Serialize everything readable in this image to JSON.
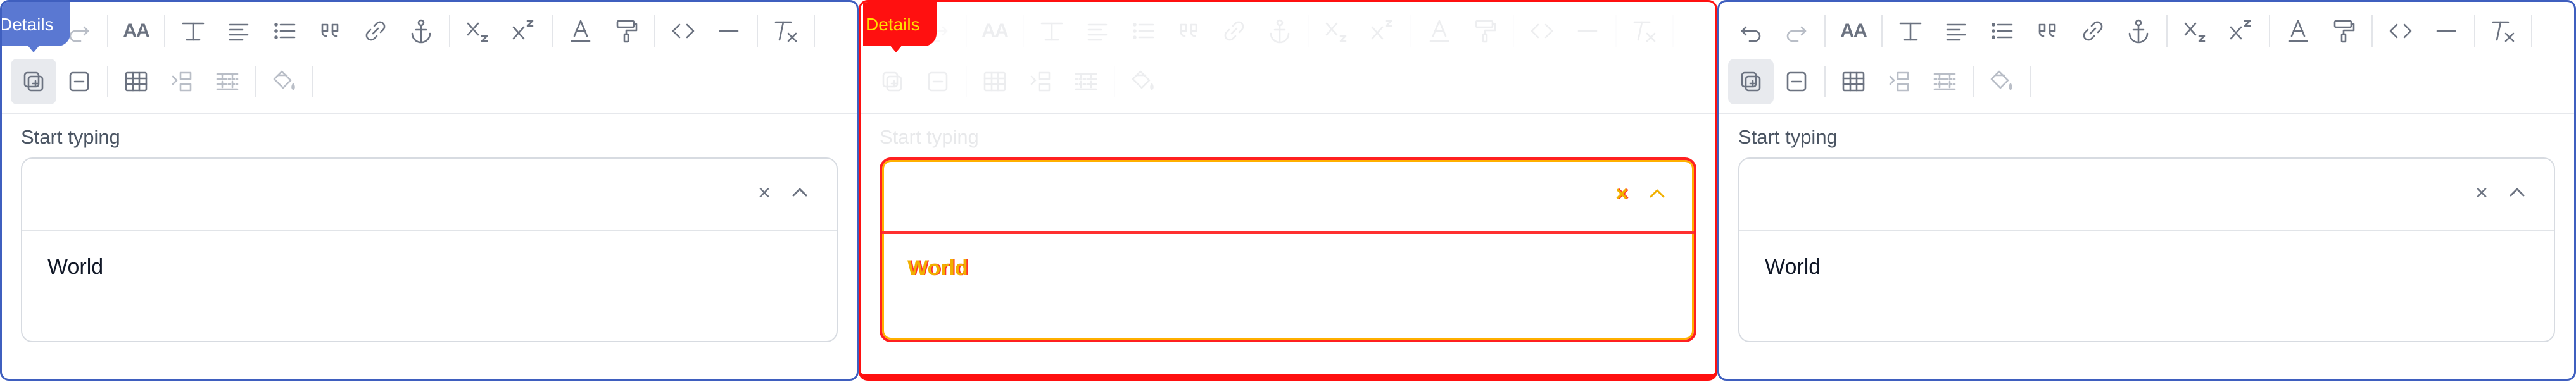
{
  "badge": {
    "label": "Details"
  },
  "field": {
    "label": "Start typing",
    "option": "World",
    "clear_glyph": "×"
  },
  "toolbar_row1": [
    {
      "name": "undo-icon"
    },
    {
      "name": "redo-icon"
    },
    {
      "name": "font-size-icon",
      "text": "AA"
    },
    {
      "name": "text-style-icon"
    },
    {
      "name": "align-icon"
    },
    {
      "name": "bullet-list-icon"
    },
    {
      "name": "quote-icon"
    },
    {
      "name": "link-icon"
    },
    {
      "name": "anchor-icon"
    },
    {
      "name": "subscript-icon"
    },
    {
      "name": "superscript-icon"
    },
    {
      "name": "text-color-icon"
    },
    {
      "name": "paint-roller-icon"
    },
    {
      "name": "code-icon"
    },
    {
      "name": "horizontal-rule-icon"
    },
    {
      "name": "clear-formatting-icon"
    }
  ],
  "toolbar_row2": [
    {
      "name": "add-block-icon"
    },
    {
      "name": "remove-block-icon"
    },
    {
      "name": "table-icon"
    },
    {
      "name": "indent-icon"
    },
    {
      "name": "row-grid-icon"
    },
    {
      "name": "fill-color-icon"
    }
  ],
  "colors": {
    "accent": "#3f5fbf",
    "badge": "#5a78d2",
    "error": "#ff1010",
    "warning": "#f1b000"
  }
}
